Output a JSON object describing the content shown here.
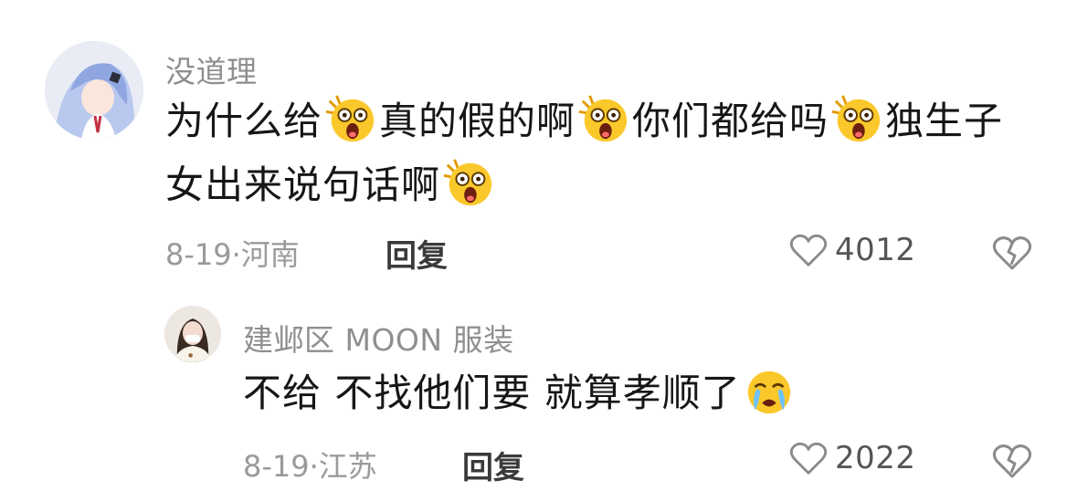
{
  "comments": [
    {
      "username": "没道理",
      "text_parts": [
        "为什么给",
        "真的假的啊",
        "你们都给吗",
        "独生子女出来说句话啊"
      ],
      "emoji": "shocked-face-emoji",
      "date": "8-19",
      "location": "河南",
      "reply_label": "回复",
      "likes": "4012"
    },
    {
      "username": "建邺区 MOON 服装",
      "text": "不给 不找他们要 就算孝顺了",
      "emoji": "crying-face-emoji",
      "date": "8-19",
      "location": "江苏",
      "reply_label": "回复",
      "likes": "2022"
    }
  ],
  "meta_separator": "·",
  "icons": {
    "like": "heart-icon",
    "dislike": "broken-heart-icon"
  },
  "colors": {
    "username": "#8f8f8f",
    "text": "#161616",
    "meta": "#9a9a9a"
  }
}
